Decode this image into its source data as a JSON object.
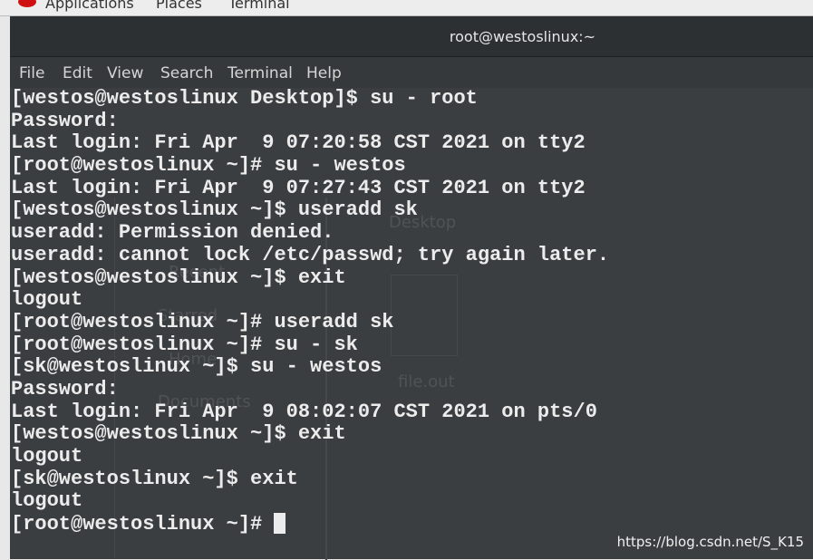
{
  "top_bar": {
    "items": [
      "Applications",
      "Places",
      "Terminal"
    ]
  },
  "window": {
    "title": "root@westoslinux:~"
  },
  "menu": [
    "File",
    "Edit",
    "View",
    "Search",
    "Terminal",
    "Help"
  ],
  "background_window": {
    "labels": [
      "Recent",
      "Starred",
      "Home",
      "Documents",
      "Desktop",
      "file.out"
    ]
  },
  "terminal_lines": [
    "[westos@westoslinux Desktop]$ su - root",
    "Password:",
    "Last login: Fri Apr  9 07:20:58 CST 2021 on tty2",
    "[root@westoslinux ~]# su - westos",
    "Last login: Fri Apr  9 07:27:43 CST 2021 on tty2",
    "[westos@westoslinux ~]$ useradd sk",
    "useradd: Permission denied.",
    "useradd: cannot lock /etc/passwd; try again later.",
    "[westos@westoslinux ~]$ exit",
    "logout",
    "[root@westoslinux ~]# useradd sk",
    "[root@westoslinux ~]# su - sk",
    "[sk@westoslinux ~]$ su - westos",
    "Password:",
    "Last login: Fri Apr  9 08:02:07 CST 2021 on pts/0",
    "[westos@westoslinux ~]$ exit",
    "logout",
    "[sk@westoslinux ~]$ exit",
    "logout",
    "[root@westoslinux ~]# "
  ],
  "watermark": "https://blog.csdn.net/S_K15"
}
